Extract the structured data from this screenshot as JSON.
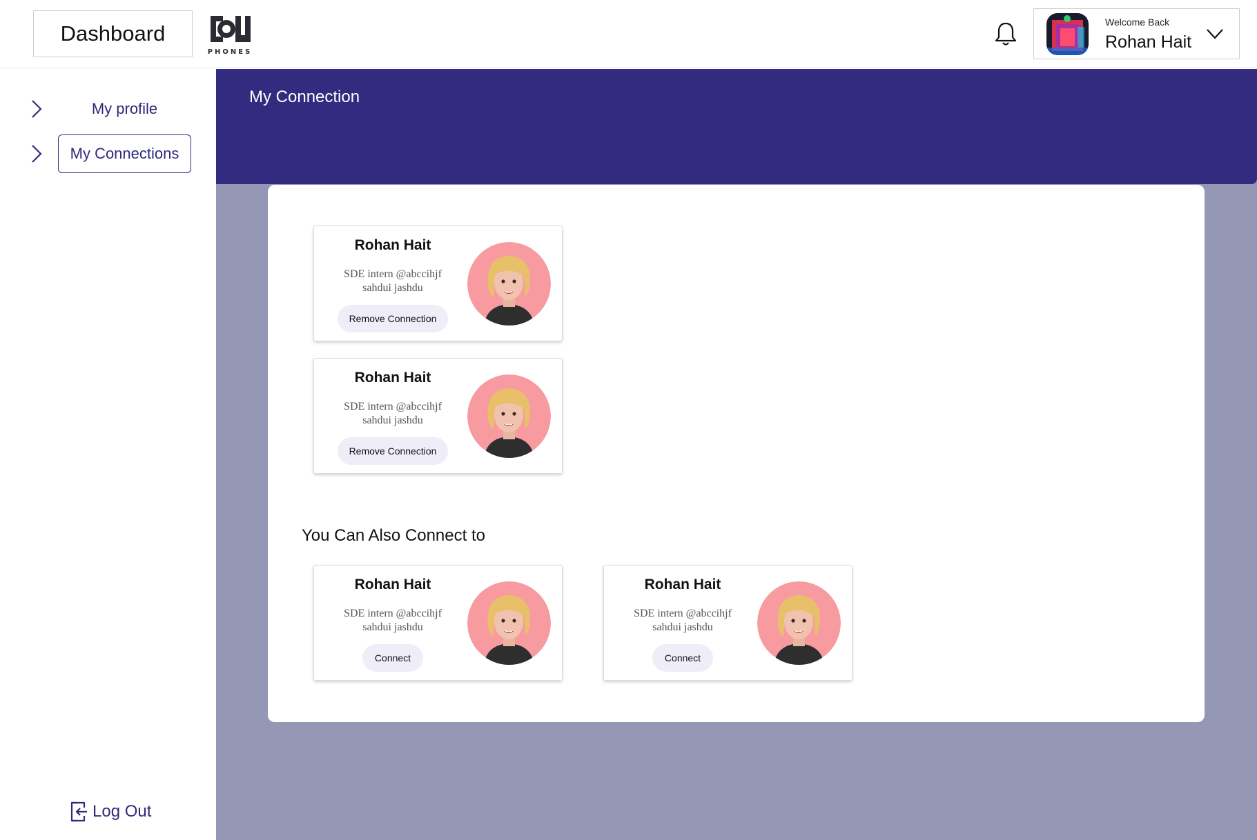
{
  "header": {
    "dashboard_label": "Dashboard",
    "logo_text": "PHONES",
    "welcome_text": "Welcome Back",
    "user_name": "Rohan Hait"
  },
  "sidebar": {
    "items": [
      {
        "label": "My profile",
        "active": false
      },
      {
        "label": "My Connections",
        "active": true
      }
    ],
    "logout_label": "Log Out"
  },
  "main": {
    "banner_title": "My Connection",
    "connections": [
      {
        "name": "Rohan Hait",
        "bio_line1": "SDE intern @abccihjf",
        "bio_line2": "sahdui jashdu",
        "button_label": "Remove Connection"
      },
      {
        "name": "Rohan Hait",
        "bio_line1": "SDE intern @abccihjf",
        "bio_line2": "sahdui jashdu",
        "button_label": "Remove Connection"
      }
    ],
    "suggest_title": "You Can Also Connect to",
    "suggestions": [
      {
        "name": "Rohan Hait",
        "bio_line1": "SDE intern @abccihjf",
        "bio_line2": "sahdui jashdu",
        "button_label": "Connect"
      },
      {
        "name": "Rohan Hait",
        "bio_line1": "SDE intern @abccihjf",
        "bio_line2": "sahdui jashdu",
        "button_label": "Connect"
      }
    ]
  },
  "colors": {
    "brand": "#322b80",
    "main_bg": "#9598b5",
    "button_bg": "#efedf7",
    "avatar_bg": "#f79ba1"
  },
  "icons": [
    "bell-icon",
    "chevron-right-icon",
    "chevron-down-icon",
    "logout-icon",
    "user-avatar-icon"
  ]
}
